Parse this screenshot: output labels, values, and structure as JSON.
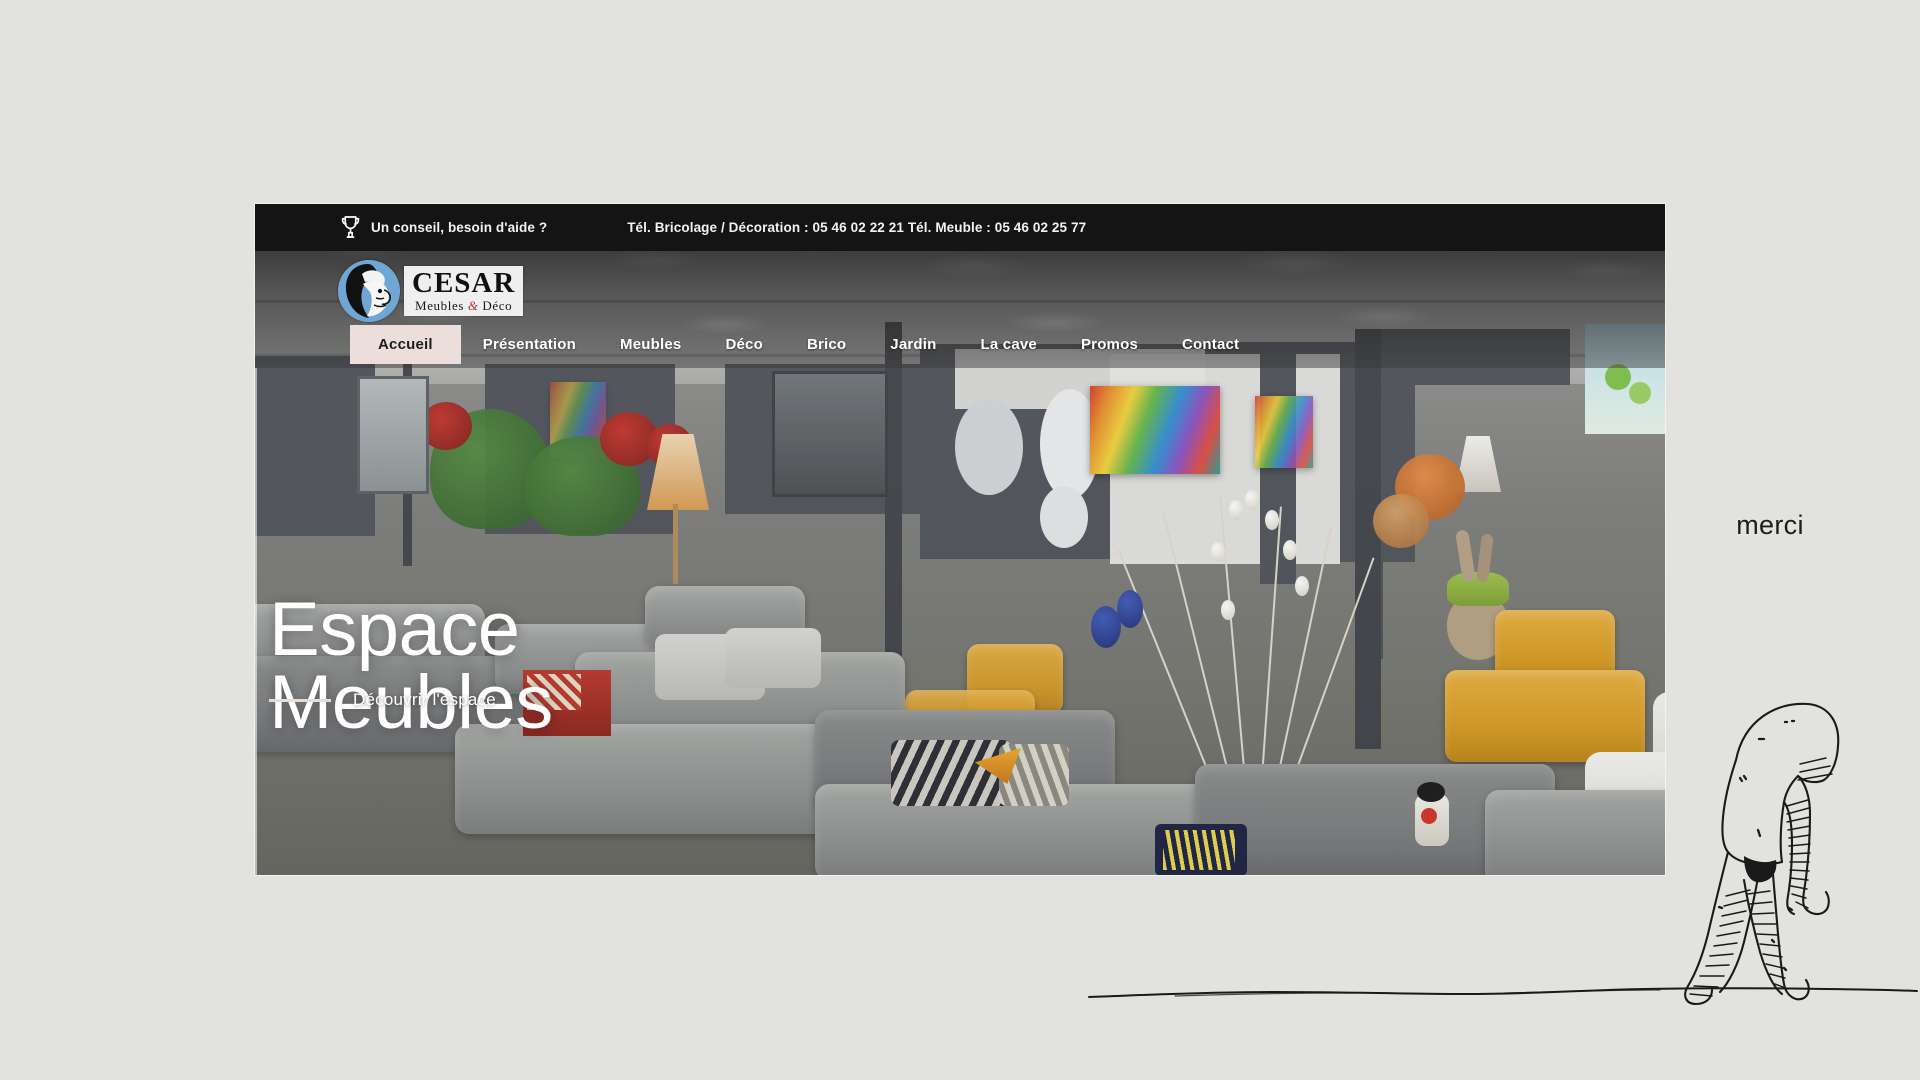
{
  "page": {
    "background_color": "#e2e3df",
    "annotation_text": "merci"
  },
  "site": {
    "topbar": {
      "help_icon": "trophy-icon",
      "help_text": "Un conseil, besoin d'aide ?",
      "phones_text": "Tél. Bricolage / Décoration : 05 46 02 22 21 Tél. Meuble : 05 46 02 25 77"
    },
    "logo": {
      "mark": "caesar-head-icon",
      "brand": "CESAR",
      "tagline_left": "Meubles ",
      "tagline_amp": "&",
      "tagline_right": " Déco",
      "badge_color": "#6fa6d4"
    },
    "nav": {
      "items": [
        {
          "label": "Accueil",
          "active": true
        },
        {
          "label": "Présentation",
          "active": false
        },
        {
          "label": "Meubles",
          "active": false
        },
        {
          "label": "Déco",
          "active": false
        },
        {
          "label": "Brico",
          "active": false
        },
        {
          "label": "Jardin",
          "active": false
        },
        {
          "label": "La cave",
          "active": false
        },
        {
          "label": "Promos",
          "active": false
        },
        {
          "label": "Contact",
          "active": false
        }
      ],
      "active_background": "#ecdfdb",
      "active_text_color": "#1e1e1e"
    },
    "hero": {
      "title": "Espace\nMeubles",
      "cta_label": "Découvrir l'espace",
      "cta_dash_color": "#e8dcd8",
      "image_alt": "Showroom de meubles : canapés gris, fauteuils moutarde, étagères, tableaux colorés"
    }
  }
}
